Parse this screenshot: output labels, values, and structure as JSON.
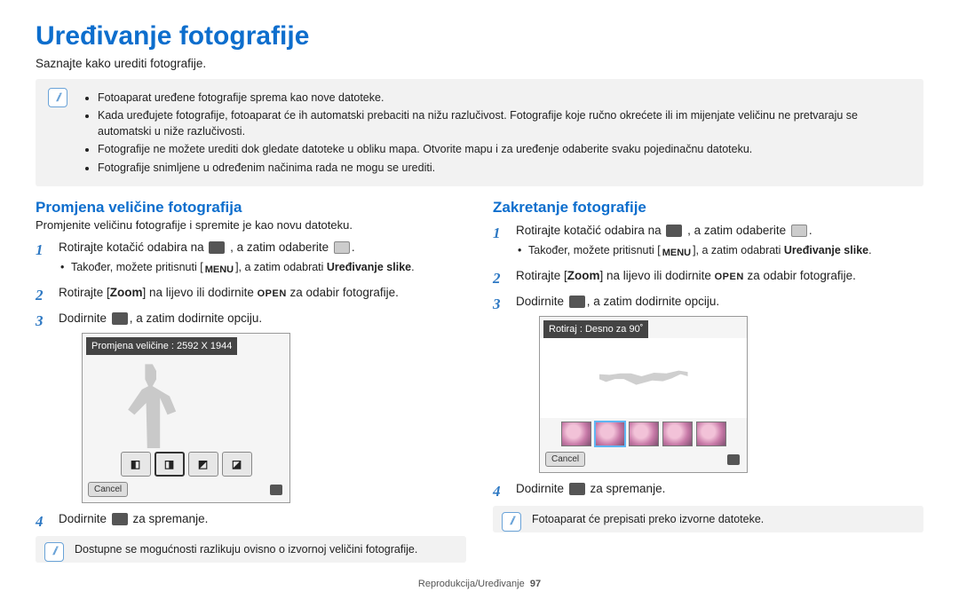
{
  "page_title": "Uređivanje fotografije",
  "lead": "Saznajte kako urediti fotografije.",
  "info_band": [
    "Fotoaparat uređene fotografije sprema kao nove datoteke.",
    "Kada uređujete fotografije, fotoaparat će ih automatski prebaciti na nižu razlučivost. Fotografije koje ručno okrećete ili im mijenjate veličinu ne pretvaraju se automatski u niže razlučivosti.",
    "Fotografije ne možete urediti dok gledate datoteke u obliku mapa. Otvorite mapu i za uređenje odaberite svaku pojedinačnu datoteku.",
    "Fotografije snimljene u određenim načinima rada ne mogu se urediti."
  ],
  "left": {
    "heading": "Promjena veličine fotografija",
    "sub": "Promjenite veličinu fotografije i spremite je kao novu datoteku.",
    "steps": {
      "1a": "Rotirajte kotačić odabira na ",
      "1b": ", a zatim odaberite ",
      "1_bullet_a": "Također, možete pritisnuti [",
      "1_bullet_menu": "MENU",
      "1_bullet_b": "], a zatim odabrati ",
      "1_bullet_bold": "Uređivanje slike",
      "2a": "Rotirajte [",
      "2b": "Zoom",
      "2c": "] na lijevo ili dodirnite ",
      "2d": "OPEN",
      "2e": " za odabir fotografije.",
      "3a": "Dodirnite ",
      "3b": ", a zatim dodirnite opciju.",
      "4a": "Dodirnite ",
      "4b": " za spremanje."
    },
    "screenshot_caption": "Promjena veličine : 2592 X 1944",
    "cancel_label": "Cancel",
    "note": "Dostupne se mogućnosti razlikuju ovisno o izvornoj veličini fotografije."
  },
  "right": {
    "heading": "Zakretanje fotografije",
    "steps": {
      "1a": "Rotirajte kotačić odabira na ",
      "1b": ", a zatim odaberite ",
      "1_bullet_a": "Također, možete pritisnuti [",
      "1_bullet_menu": "MENU",
      "1_bullet_b": "], a zatim odabrati ",
      "1_bullet_bold": "Uređivanje slike",
      "2a": "Rotirajte [",
      "2b": "Zoom",
      "2c": "] na lijevo ili dodirnite ",
      "2d": "OPEN",
      "2e": " za odabir fotografije.",
      "3a": "Dodirnite ",
      "3b": ", a zatim dodirnite opciju.",
      "4a": "Dodirnite ",
      "4b": " za spremanje."
    },
    "screenshot_caption": "Rotiraj : Desno za 90˚",
    "cancel_label": "Cancel",
    "note": "Fotoaparat će prepisati preko izvorne datoteke."
  },
  "footer_label": "Reprodukcija/Uređivanje",
  "footer_page": "97"
}
